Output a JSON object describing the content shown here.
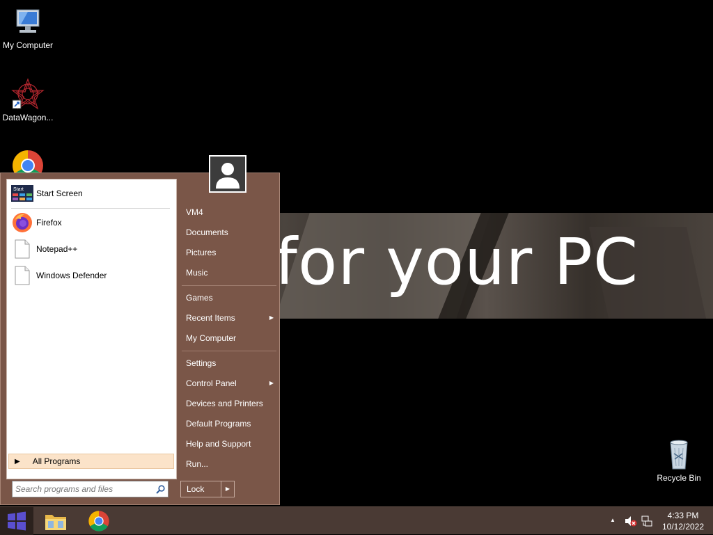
{
  "desktop": {
    "icons": [
      {
        "label": "My Computer"
      },
      {
        "label": "DataWagon..."
      },
      {
        "label": "Recycle Bin"
      }
    ],
    "wallpaper_text": "n for your PC"
  },
  "start_menu": {
    "pinned": [
      {
        "label": "Start Screen",
        "icon_text": "Start"
      },
      {
        "label": "Firefox"
      },
      {
        "label": "Notepad++"
      },
      {
        "label": "Windows Defender"
      }
    ],
    "all_programs": "All Programs",
    "search_placeholder": "Search programs and files",
    "right_items": [
      {
        "label": "VM4"
      },
      {
        "label": "Documents"
      },
      {
        "label": "Pictures"
      },
      {
        "label": "Music"
      },
      {
        "label": "Games"
      },
      {
        "label": "Recent Items",
        "submenu": true
      },
      {
        "label": "My Computer"
      },
      {
        "label": "Settings"
      },
      {
        "label": "Control Panel",
        "submenu": true
      },
      {
        "label": "Devices and Printers"
      },
      {
        "label": "Default Programs"
      },
      {
        "label": "Help and Support"
      },
      {
        "label": "Run..."
      }
    ],
    "lock_label": "Lock"
  },
  "taskbar": {
    "apps": [
      "file-explorer",
      "chrome"
    ],
    "time": "4:33 PM",
    "date": "10/12/2022"
  },
  "colors": {
    "menu_bg": "#7a5648",
    "taskbar_bg": "#4a3a34",
    "highlight": "#fbe3c9"
  }
}
